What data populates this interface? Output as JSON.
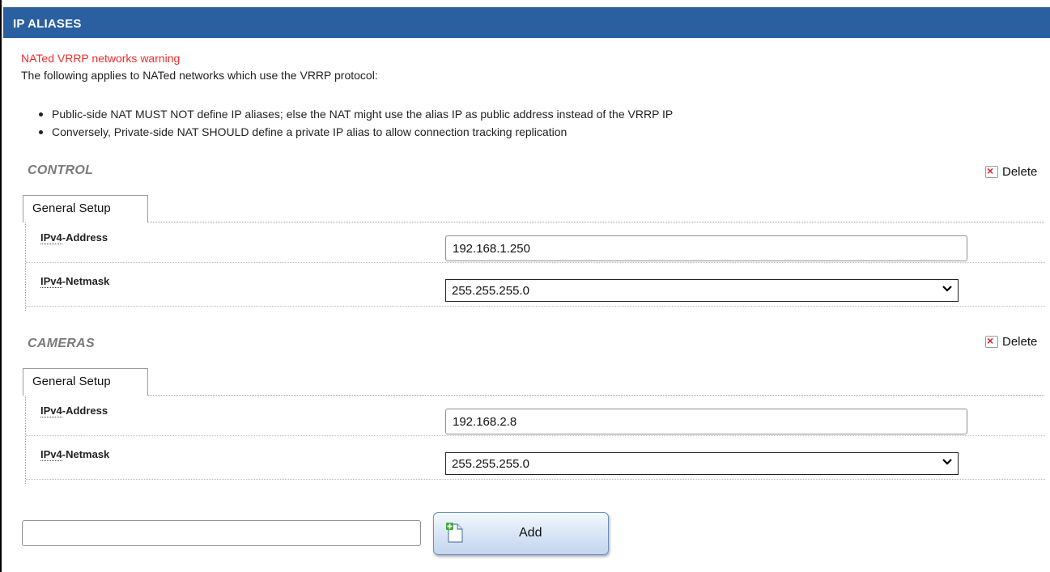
{
  "header": {
    "title": "IP ALIASES"
  },
  "warning": {
    "title": "NATed VRRP networks warning",
    "intro": "The following applies to NATed networks which use the VRRP protocol:",
    "bullets": [
      "Public-side NAT MUST NOT define IP aliases; else the NAT might use the alias IP as public address instead of the VRRP IP",
      "Conversely, Private-side NAT SHOULD define a private IP alias to allow connection tracking replication"
    ]
  },
  "sections": [
    {
      "title": "CONTROL",
      "delete_label": "Delete",
      "tab_label": "General Setup",
      "address_label_abbr": "IPv4",
      "address_label_rest": "-Address",
      "address_value": "192.168.1.250",
      "netmask_label_abbr": "IPv4",
      "netmask_label_rest": "-Netmask",
      "netmask_value": "255.255.255.0"
    },
    {
      "title": "CAMERAS",
      "delete_label": "Delete",
      "tab_label": "General Setup",
      "address_label_abbr": "IPv4",
      "address_label_rest": "-Address",
      "address_value": "192.168.2.8",
      "netmask_label_abbr": "IPv4",
      "netmask_label_rest": "-Netmask",
      "netmask_value": "255.255.255.0"
    }
  ],
  "add": {
    "input_value": "",
    "button_label": "Add"
  },
  "colors": {
    "header_bg": "#2a5fa0",
    "warning_text": "#ef2d2d",
    "section_title": "#7a7a7a"
  },
  "icons": {
    "delete": "delete-icon",
    "add": "add-section-icon",
    "select_arrow": "chevron-down-icon"
  }
}
